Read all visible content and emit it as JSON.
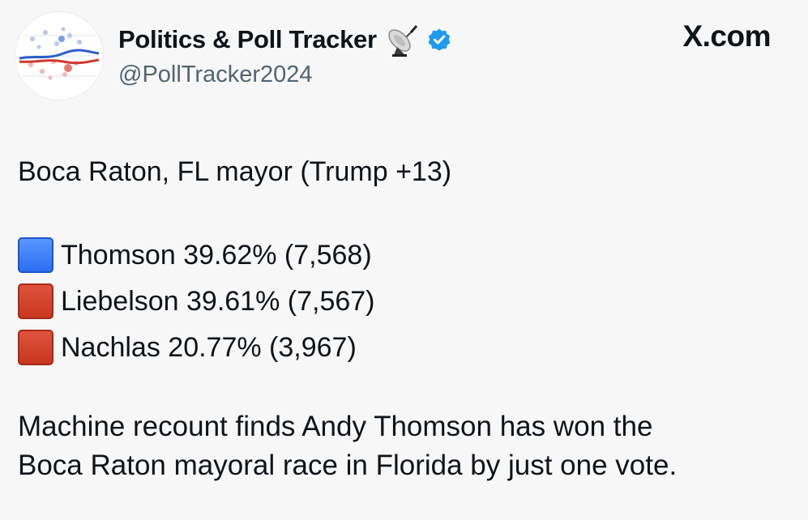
{
  "account": {
    "display_name": "Politics & Poll Tracker",
    "handle": "@PollTracker2024",
    "avatar_icon": "poll-chart-avatar",
    "name_emoji": "satellite-dish-icon",
    "verified_icon": "verified-badge-icon",
    "verified_color": "#1d9bf0"
  },
  "brand": {
    "label": "X.com"
  },
  "post": {
    "headline": "Boca Raton, FL mayor (Trump +13)",
    "results": [
      {
        "color_icon": "blue-square-icon",
        "color": "#2b6ef2",
        "text": "Thomson 39.62% (7,568)"
      },
      {
        "color_icon": "red-square-icon",
        "color": "#c8371f",
        "text": "Liebelson 39.61% (7,567)"
      },
      {
        "color_icon": "red-square-icon",
        "color": "#c8371f",
        "text": "Nachlas 20.77% (3,967)"
      }
    ],
    "body_line_1": "Machine recount finds Andy Thomson has won the",
    "body_line_2": "Boca Raton mayoral race in Florida by just one vote."
  }
}
